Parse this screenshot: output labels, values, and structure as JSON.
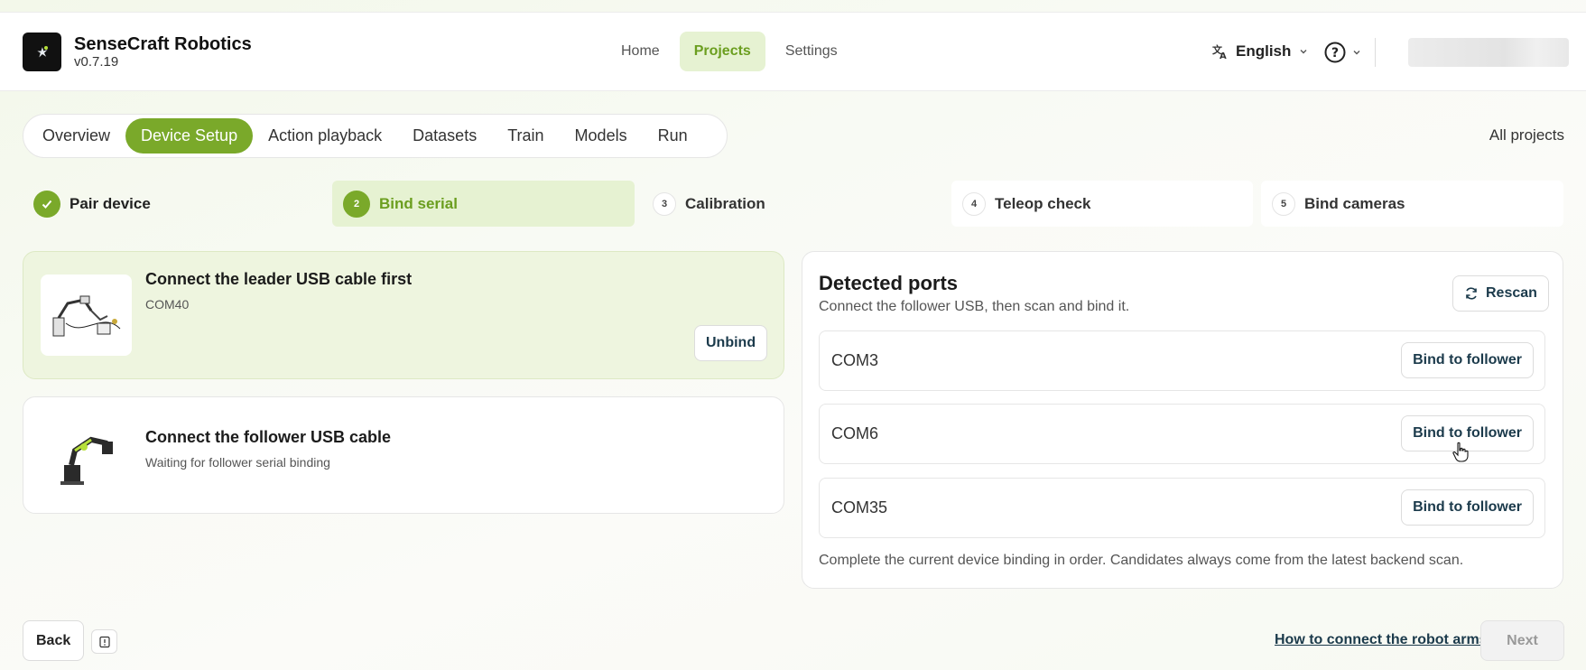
{
  "app": {
    "title": "SenseCraft Robotics",
    "version": "v0.7.19"
  },
  "nav": [
    {
      "label": "Home",
      "active": false
    },
    {
      "label": "Projects",
      "active": true
    },
    {
      "label": "Settings",
      "active": false
    }
  ],
  "header": {
    "language": "English",
    "language_icon": "translate-icon",
    "help_icon": "help-circle-icon"
  },
  "tabs": [
    {
      "label": "Overview",
      "active": false
    },
    {
      "label": "Device Setup",
      "active": true
    },
    {
      "label": "Action playback",
      "active": false
    },
    {
      "label": "Datasets",
      "active": false
    },
    {
      "label": "Train",
      "active": false
    },
    {
      "label": "Models",
      "active": false
    },
    {
      "label": "Run",
      "active": false
    }
  ],
  "all_projects": "All projects",
  "steps": [
    {
      "number": "",
      "label": "Pair device",
      "state": "done"
    },
    {
      "number": "2",
      "label": "Bind serial",
      "state": "active"
    },
    {
      "number": "3",
      "label": "Calibration",
      "state": "pending"
    },
    {
      "number": "4",
      "label": "Teleop check",
      "state": "pending"
    },
    {
      "number": "5",
      "label": "Bind cameras",
      "state": "pending"
    }
  ],
  "leader": {
    "title": "Connect the leader USB cable first",
    "port": "COM40",
    "unbind_label": "Unbind"
  },
  "follower": {
    "title": "Connect the follower USB cable",
    "status": "Waiting for follower serial binding"
  },
  "ports": {
    "title": "Detected ports",
    "subtitle": "Connect the follower USB, then scan and bind it.",
    "rescan_label": "Rescan",
    "items": [
      {
        "name": "COM3",
        "action": "Bind to follower"
      },
      {
        "name": "COM6",
        "action": "Bind to follower"
      },
      {
        "name": "COM35",
        "action": "Bind to follower"
      }
    ],
    "footer": "Complete the current device binding in order. Candidates always come from the latest backend scan."
  },
  "footer": {
    "back_label": "Back",
    "help_link": "How to connect the robot arms",
    "next_label": "Next"
  },
  "colors": {
    "accent": "#7aa92a",
    "accent_light": "#e6f2d2",
    "leader_bg": "#eef5df"
  }
}
